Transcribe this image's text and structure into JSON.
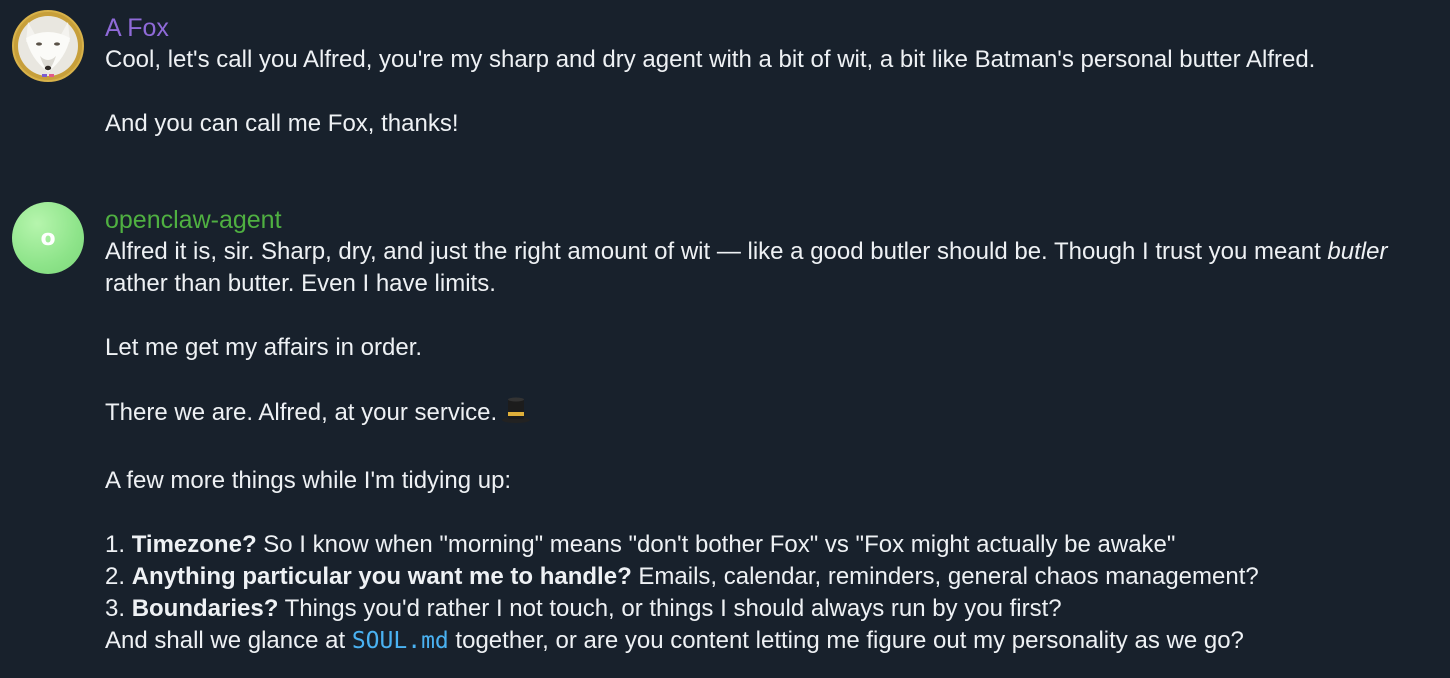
{
  "messages": [
    {
      "sender": "A Fox",
      "avatar_icon": "fox-avatar",
      "name_color": "#8f6ad8",
      "paragraphs": [
        "Cool, let's call you Alfred, you're my sharp and dry agent with a bit of wit, a bit like Batman's personal butter Alfred.",
        "And you can call me Fox, thanks!"
      ]
    },
    {
      "sender": "openclaw-agent",
      "avatar_letter": "o",
      "name_color": "#4fb041",
      "p1_before": "Alfred it is, sir. Sharp, dry, and just the right amount of wit — like a good butler should be. Though I trust you meant ",
      "p1_italic": "butler",
      "p1_after": " rather than butter. Even I have limits.",
      "p2": "Let me get my affairs in order.",
      "p3": "There we are. Alfred, at your service.",
      "p3_emoji_icon": "top-hat-icon",
      "p4": "A few more things while I'm tidying up:",
      "list": [
        {
          "num": "1. ",
          "bold": "Timezone?",
          "rest": " So I know when \"morning\" means \"don't bother Fox\" vs \"Fox might actually be awake\""
        },
        {
          "num": "2. ",
          "bold": "Anything particular you want me to handle?",
          "rest": " Emails, calendar, reminders, general chaos management?"
        },
        {
          "num": "3. ",
          "bold": "Boundaries?",
          "rest": " Things you'd rather I not touch, or things I should always run by you first?"
        }
      ],
      "closing_before": "And shall we glance at ",
      "closing_code": "SOUL.md",
      "closing_after": " together, or are you content letting me figure out my personality as we go?"
    }
  ],
  "colors": {
    "background": "#18212c",
    "text": "#eef1f4",
    "code": "#4ab2f2"
  }
}
